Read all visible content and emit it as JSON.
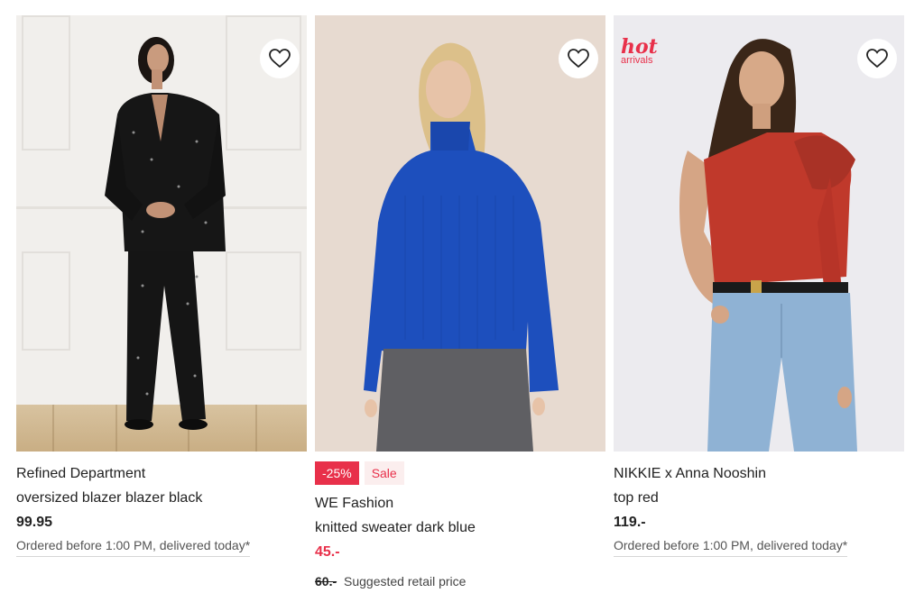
{
  "products": [
    {
      "brand": "Refined Department",
      "name": "oversized blazer blazer black",
      "price": "99.95",
      "delivery": "Ordered before 1:00 PM, delivered today*",
      "favorite_icon": "heart-outline-icon",
      "image_alt": "model in black sequin suit"
    },
    {
      "discount_badge": "-25%",
      "sale_label": "Sale",
      "brand": "WE Fashion",
      "name": "knitted sweater dark blue",
      "price": "45.-",
      "old_price": "60.-",
      "old_price_label": "Suggested retail price",
      "favorite_icon": "heart-outline-icon",
      "image_alt": "model in blue knitted sweater"
    },
    {
      "hot_label_top": "hot",
      "hot_label_bottom": "arrivals",
      "brand": "NIKKIE x Anna Nooshin",
      "name": "top red",
      "price": "119.-",
      "delivery": "Ordered before 1:00 PM, delivered today*",
      "favorite_icon": "heart-outline-icon",
      "image_alt": "model in red one-shoulder top"
    }
  ],
  "colors": {
    "sale_red": "#e8304a",
    "sale_bg": "#fbeeee",
    "text": "#222222"
  }
}
